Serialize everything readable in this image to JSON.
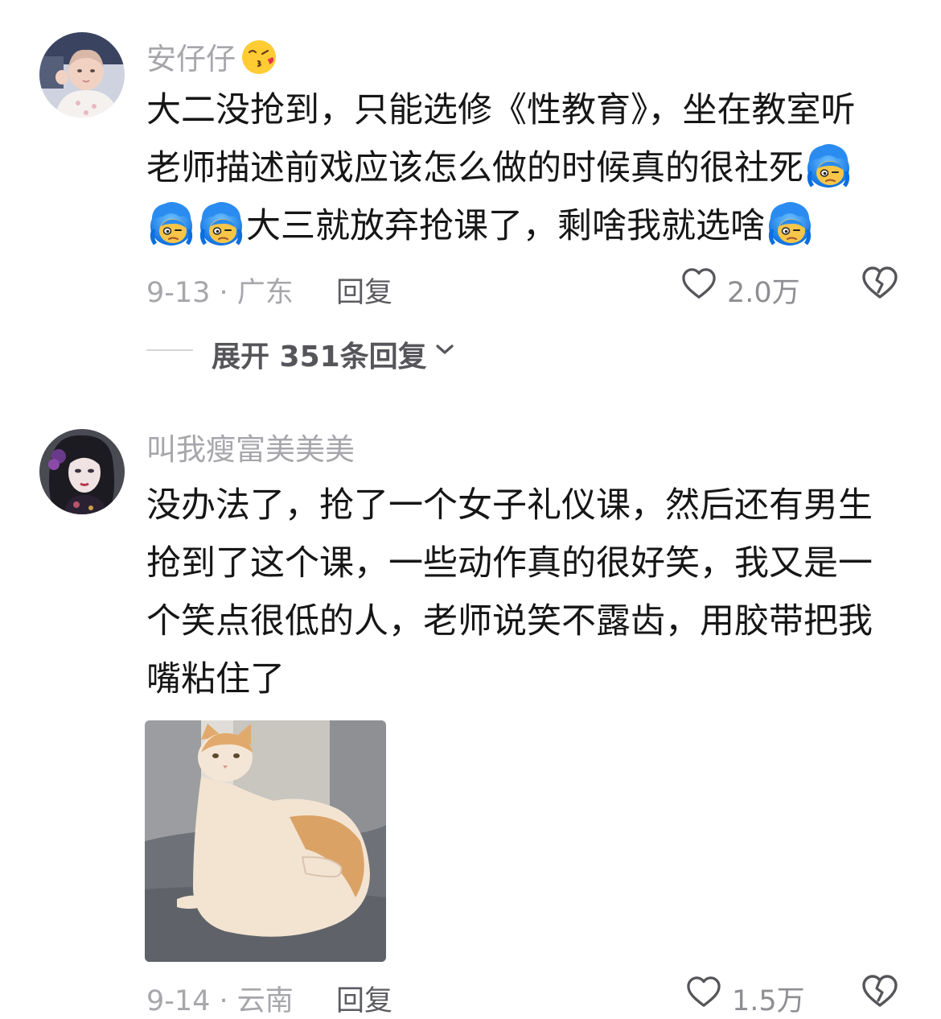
{
  "comments": [
    {
      "username": "安仔仔",
      "lines": [
        "大二没抢到，只能选修《性教育》，坐在教室听",
        "老师描述前戏应该怎么做的时候真的很社死",
        "大三就放弃抢课了，剩啥我就选啥"
      ],
      "date_location": "9-13 · 广东",
      "reply_label": "回复",
      "like_count": "2.0万",
      "expand_label": "展开 351条回复",
      "emoji_name_inline": "blue-hair-awkward-emoji",
      "emoji_name_username": "kiss-face-emoji"
    },
    {
      "username": "叫我瘦富美美美",
      "lines": [
        "没办法了，抢了一个女子礼仪课，然后还有男生",
        "抢到了这个课，一些动作真的很好笑，我又是一",
        "个笑点很低的人，老师说笑不露齿，用胶带把我",
        "嘴粘住了"
      ],
      "date_location": "9-14 · 云南",
      "reply_label": "回复",
      "like_count": "1.5万",
      "attachment": "cat-photo"
    }
  ],
  "colors": {
    "username": "#a6a6ab",
    "body_text": "#161616",
    "meta_text": "#a6a6ab",
    "reply_text": "#5b5b60",
    "icon_stroke": "#55555a",
    "emoji_hair": "#1e8cff"
  }
}
